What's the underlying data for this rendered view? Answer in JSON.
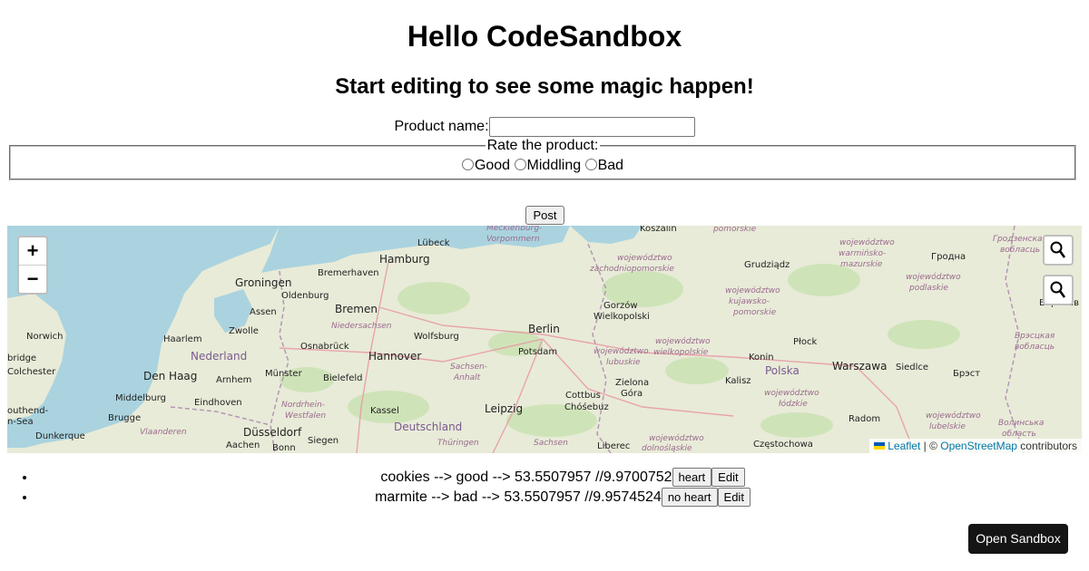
{
  "heading": "Hello CodeSandbox",
  "subheading": "Start editing to see some magic happen!",
  "form": {
    "product_label": "Product name:",
    "product_value": "",
    "rating_legend": "Rate the product:",
    "options": [
      "Good",
      "Middling",
      "Bad"
    ],
    "post_label": "Post"
  },
  "map": {
    "zoom_in": "+",
    "zoom_out": "−",
    "search_icons": [
      "search-icon",
      "search-icon"
    ],
    "labels": {
      "koszalin": "Koszalin",
      "pomorskie": "pomorskie",
      "lubeck": "Lübeck",
      "mecklenburg": "Mecklenburg-",
      "vorpommern": "Vorpommern",
      "woj_zach": "województwo",
      "zachodniopomorskie": "zachodniopomorskie",
      "hamburg": "Hamburg",
      "bremerhaven": "Bremerhaven",
      "groningen": "Groningen",
      "oldenburg": "Oldenburg",
      "bremen": "Bremen",
      "assen": "Assen",
      "niedersachsen": "Niedersachsen",
      "zwolle": "Zwolle",
      "norwich": "Norwich",
      "haarlem": "Haarlem",
      "nederland": "Nederland",
      "osnabruck": "Osnabrück",
      "hannover": "Hannover",
      "wolfsburg": "Wolfsburg",
      "berlin": "Berlin",
      "potsdam": "Potsdam",
      "bridge": "bridge",
      "colchester": "Colchester",
      "den_haag": "Den Haag",
      "arnhem": "Arnhem",
      "munster": "Münster",
      "bielefeld": "Bielefeld",
      "sachsen_anhalt_1": "Sachsen-",
      "sachsen_anhalt_2": "Anhalt",
      "middelburg": "Middelburg",
      "eindhoven": "Eindhoven",
      "nrw_1": "Nordrhein-",
      "nrw_2": "Westfalen",
      "kassel": "Kassel",
      "leipzig": "Leipzig",
      "deutschland": "Deutschland",
      "southend": "outhend-",
      "on_sea": "n-Sea",
      "brugge": "Brugge",
      "dunkerque": "Dunkerque",
      "vlaanderen": "Vlaanderen",
      "dusseldorf": "Düsseldorf",
      "aachen": "Aachen",
      "bonn": "Bonn",
      "siegen": "Siegen",
      "thuringen": "Thüringen",
      "sachsen": "Sachsen",
      "cottbus": "Cottbus",
      "chosebuz": "Chóśebuz",
      "gorzow": "Gorzów",
      "wielkopolski": "Wielkopolski",
      "woj_lub": "województwo",
      "lubuskie": "lubuskie",
      "zielona": "Zielona",
      "gora": "Góra",
      "liberec": "Liberec",
      "woj_dol": "województwo",
      "dolnoslaskie": "dolnośląskie",
      "grudziadz": "Grudziądz",
      "woj_kp": "województwo",
      "kujawsko": "kujawsko-",
      "pomorskie2": "pomorskie",
      "woj_wlkp": "województwo",
      "wielkopolskie": "wielkopolskie",
      "konin": "Konin",
      "plock": "Płock",
      "kalisz": "Kalisz",
      "polska": "Polska",
      "warszawa": "Warszawa",
      "siedlce": "Siedlce",
      "woj_lodz": "województwo",
      "lodzkie": "łódzkie",
      "radom": "Radom",
      "czestochowa": "Częstochowa",
      "woj_wm": "województwo",
      "warminsko": "warmińsko-",
      "mazurskie": "mazurskie",
      "woj_pdl": "województwo",
      "podlaskie": "podlaskie",
      "woj_lbl": "województwo",
      "lubelskie": "lubelskie",
      "grodna": "Гродна",
      "grodz_1": "Гродзенская",
      "grodz_2": "вобласць",
      "brest": "Брэст",
      "brest_obl_1": "Брэсцкая",
      "brest_obl_2": "вобласць",
      "volyn_1": "Волинська",
      "volyn_2": "область",
      "baranav": "Баранав"
    },
    "attribution": {
      "leaflet": "Leaflet",
      "separator": " | © ",
      "osm": "OpenStreetMap",
      "contributors": " contributors"
    }
  },
  "products": [
    {
      "text": "cookies --> good --> 53.5507957 //9.9700752",
      "heart": "heart",
      "edit": "Edit"
    },
    {
      "text": "marmite --> bad --> 53.5507957 //9.9574524",
      "heart": "no heart",
      "edit": "Edit"
    }
  ],
  "open_sandbox": "Open Sandbox",
  "colors": {
    "map_land": "#e8ebd8",
    "water": "#aad3df",
    "link": "#0078a8",
    "sandbox_button": "#151515"
  }
}
